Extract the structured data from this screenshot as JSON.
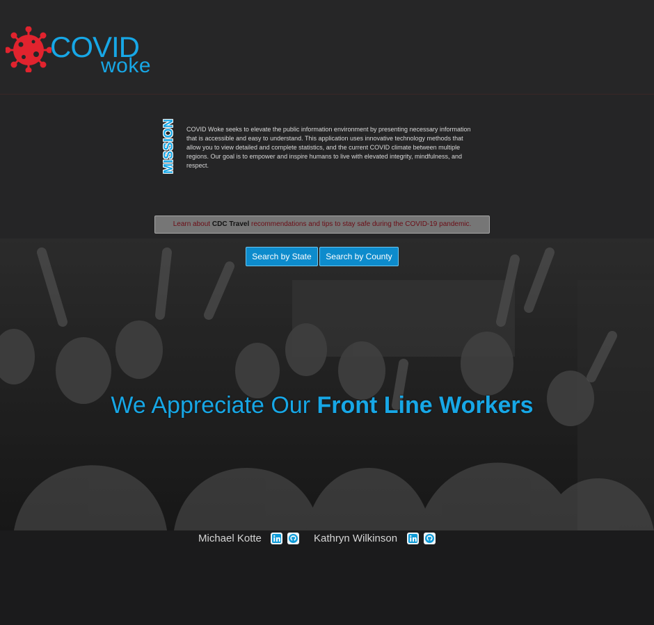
{
  "header": {
    "logo_primary": "COVID",
    "logo_secondary": "woke",
    "logo_color": "#17a7e6",
    "virus_color": "#e1232e"
  },
  "mission": {
    "label": "MISSION",
    "text": "COVID Woke seeks to elevate the public information environment by presenting necessary information that is accessible and easy to understand. This application uses innovative technology methods that allow you to view detailed and complete statistics, and the current COVID climate between multiple regions. Our goal is to empower and inspire humans to live with elevated integrity, mindfulness, and respect."
  },
  "cdc_banner": {
    "prefix": "Learn about ",
    "link_text": "CDC Travel",
    "suffix": " recommendations and tips to stay safe during the COVID-19 pandemic."
  },
  "search": {
    "by_state": "Search by State",
    "by_county": "Search by County"
  },
  "hero": {
    "title_plain": "We Appreciate Our ",
    "title_strong": "Front Line Workers"
  },
  "credits": [
    {
      "name": "Michael Kotte",
      "icons": [
        "linkedin-icon",
        "github-icon"
      ]
    },
    {
      "name": "Kathryn Wilkinson",
      "icons": [
        "linkedin-icon",
        "github-icon"
      ]
    }
  ]
}
